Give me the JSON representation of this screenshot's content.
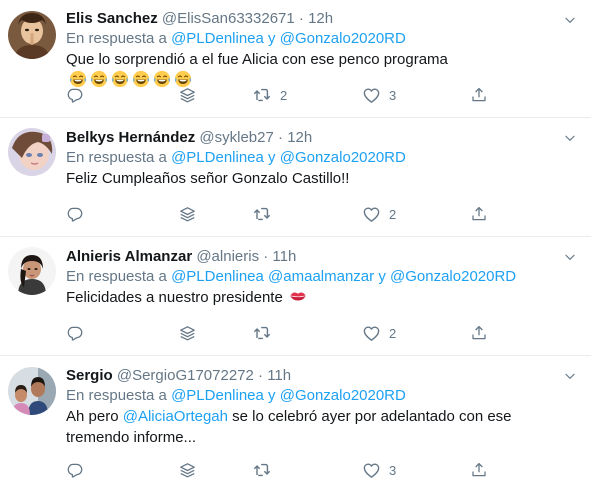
{
  "tweets": [
    {
      "name": "Elis Sanchez",
      "handle": "@ElisSan63332671",
      "time": "12h",
      "reply_prefix": "En respuesta a",
      "reply_mention_1": "@PLDenlinea",
      "reply_join": "y",
      "reply_mention_2": "@Gonzalo2020RD",
      "text": "Que lo sorprendió a el fue Alicia con ese penco programa",
      "emoji_count": 6,
      "emoji": "face-with-tears-of-joy",
      "retweets": "2",
      "likes": "3"
    },
    {
      "name": "Belkys Hernández",
      "handle": "@sykleb27",
      "time": "12h",
      "reply_prefix": "En respuesta a",
      "reply_mention_1": "@PLDenlinea",
      "reply_join": "y",
      "reply_mention_2": "@Gonzalo2020RD",
      "text": "Feliz Cumpleaños señor Gonzalo Castillo!!",
      "retweets": "",
      "likes": "2"
    },
    {
      "name": "Alnieris Almanzar",
      "handle": "@alnieris",
      "time": "11h",
      "reply_prefix": "En respuesta a",
      "reply_mention_1": "@PLDenlinea",
      "reply_mention_2": "@amaalmanzar",
      "reply_join": "y",
      "reply_mention_3": "@Gonzalo2020RD",
      "text": "Felicidades a nuestro presidente",
      "emoji": "kiss-mark",
      "retweets": "",
      "likes": "2"
    },
    {
      "name": "Sergio",
      "handle": "@SergioG17072272",
      "time": "11h",
      "reply_prefix": "En respuesta a",
      "reply_mention_1": "@PLDenlinea",
      "reply_join": "y",
      "reply_mention_2": "@Gonzalo2020RD",
      "text_before": "Ah pero",
      "text_mention": "@AliciaOrtegah",
      "text_after": "se lo celebró ayer por adelantado con ese",
      "text_line2": "tremendo informe...",
      "retweets": "",
      "likes": "3"
    }
  ],
  "dot": "·",
  "icons": {
    "reply": "reply-icon",
    "stack": "stack-icon",
    "retweet": "retweet-icon",
    "like": "heart-icon",
    "share": "share-icon",
    "more": "chevron-down-icon"
  },
  "colors": {
    "mention": "#1da1f2",
    "secondary": "#657786",
    "text": "#14171a",
    "divider": "#e6ecf0"
  }
}
